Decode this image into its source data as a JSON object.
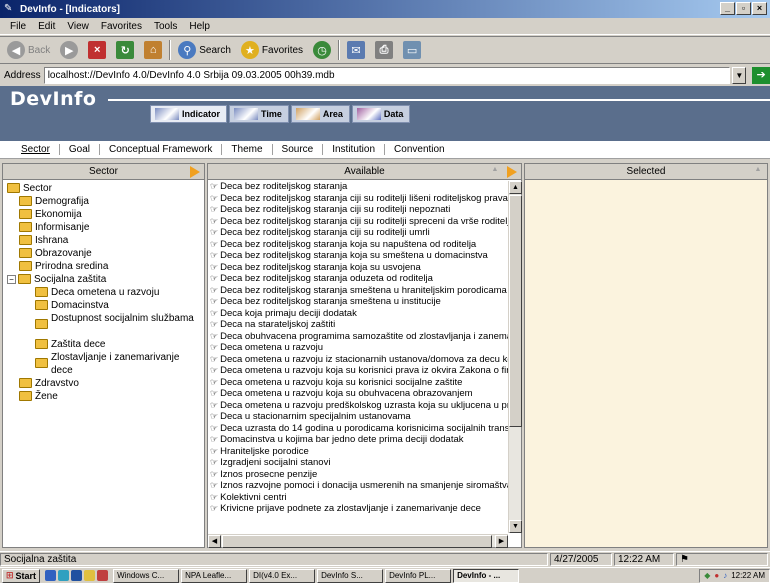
{
  "window": {
    "title": "DevInfo - [Indicators]",
    "controls": [
      "_",
      "▫",
      "×"
    ]
  },
  "menu": [
    "File",
    "Edit",
    "View",
    "Favorites",
    "Tools",
    "Help"
  ],
  "toolbar": {
    "back": "Back",
    "search": "Search",
    "favorites": "Favorites"
  },
  "address": {
    "label": "Address",
    "value": "localhost://DevInfo 4.0/DevInfo 4.0 Srbija 09.03.2005 00h39.mdb"
  },
  "app": {
    "logo": "DevInfo"
  },
  "nav_tabs": [
    {
      "label": "Indicator",
      "active": true
    },
    {
      "label": "Time",
      "active": false
    },
    {
      "label": "Area",
      "active": false
    },
    {
      "label": "Data",
      "active": false
    }
  ],
  "sub_tabs": [
    {
      "label": "Sector",
      "active": true
    },
    {
      "label": "Goal",
      "active": false
    },
    {
      "label": "Conceptual Framework",
      "active": false
    },
    {
      "label": "Theme",
      "active": false
    },
    {
      "label": "Source",
      "active": false
    },
    {
      "label": "Institution",
      "active": false
    },
    {
      "label": "Convention",
      "active": false
    }
  ],
  "panels": {
    "sector": "Sector",
    "available": "Available",
    "selected": "Selected"
  },
  "tree": [
    {
      "label": "Sector",
      "level": 0,
      "expander": ""
    },
    {
      "label": "Demografija",
      "level": 1,
      "expander": ""
    },
    {
      "label": "Ekonomija",
      "level": 1,
      "expander": ""
    },
    {
      "label": "Informisanje",
      "level": 1,
      "expander": ""
    },
    {
      "label": "Ishrana",
      "level": 1,
      "expander": ""
    },
    {
      "label": "Obrazovanje",
      "level": 1,
      "expander": ""
    },
    {
      "label": "Prirodna sredina",
      "level": 1,
      "expander": ""
    },
    {
      "label": "Socijalna zaštita",
      "level": 1,
      "expander": "−"
    },
    {
      "label": "Deca ometena u razvoju",
      "level": 2,
      "expander": ""
    },
    {
      "label": "Domacinstva",
      "level": 2,
      "expander": ""
    },
    {
      "label": "Dostupnost socijalnim službama",
      "level": 2,
      "expander": "",
      "tall": true
    },
    {
      "label": "Zaštita dece",
      "level": 2,
      "expander": ""
    },
    {
      "label": "Zlostavljanje i zanemarivanje dece",
      "level": 2,
      "expander": "",
      "tall": true
    },
    {
      "label": "Zdravstvo",
      "level": 1,
      "expander": ""
    },
    {
      "label": "Žene",
      "level": 1,
      "expander": ""
    }
  ],
  "available": [
    "Deca bez roditeljskog staranja",
    "Deca bez roditeljskog staranja ciji su roditelji lišeni roditeljskog prava",
    "Deca bez roditeljskog staranja ciji su roditelji nepoznati",
    "Deca bez roditeljskog staranja ciji su roditelji spreceni da vrše roditelj",
    "Deca bez roditeljskog staranja ciji su roditelji umrli",
    "Deca bez roditeljskog staranja koja su napuštena od roditelja",
    "Deca bez roditeljskog staranja koja su smeštena u domacinstva",
    "Deca bez roditeljskog staranja koja su usvojena",
    "Deca bez roditeljskog staranja oduzeta od roditelja",
    "Deca bez roditeljskog staranja smeštena u hraniteljskim porodicama",
    "Deca bez roditeljskog staranja smeštena u institucije",
    "Deca koja primaju deciji dodatak",
    "Deca na starateljskoj zaštiti",
    "Deca obuhvacena programima samozaštite od zlostavljanja i zanema",
    "Deca ometena u razvoju",
    "Deca ometena u razvoju iz stacionarnih ustanova/domova za decu koj",
    "Deca ometena u razvoju koja su korisnici prava iz okvira Zakona o fina",
    "Deca ometena u razvoju koja su korisnici socijalne zaštite",
    "Deca ometena u razvoju koja su obuhvacena obrazovanjem",
    "Deca ometena u razvoju predškolskog uzrasta koja su ukljucena u pr.",
    "Deca u stacionarnim specijalnim ustanovama",
    "Deca uzrasta do 14 godina u porodicama korisnicima socijalnih trans",
    "Domacinstva u kojima bar jedno dete prima deciji dodatak",
    "Hraniteljske porodice",
    "Izgradjeni socijalni stanovi",
    "Iznos prosecne penzije",
    "Iznos razvojne pomoci i donacija usmerenih na smanjenje siromaštva",
    "Kolektivni centri",
    "Krivicne prijave podnete za zlostavljanje i zanemarivanje dece"
  ],
  "status": {
    "left": "Socijalna zaštita",
    "date": "4/27/2005",
    "time": "12:22 AM"
  },
  "taskbar": {
    "start": "Start",
    "tasks": [
      "Windows C...",
      "NPA Leafle...",
      "DI(v4.0 Ex...",
      "DevInfo S...",
      "DevInfo PL...",
      "DevInfo - ..."
    ],
    "clock": "12:22 AM"
  }
}
